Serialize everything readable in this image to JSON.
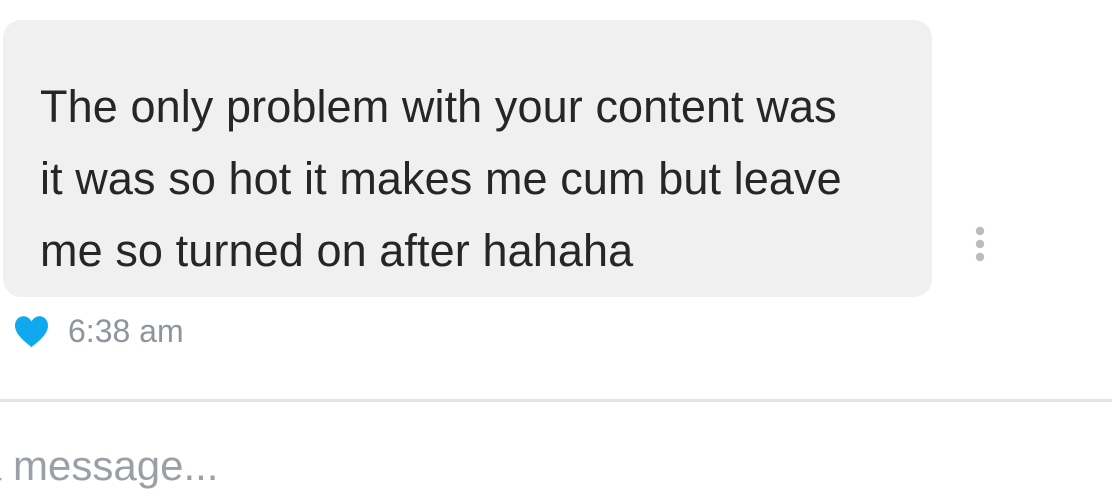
{
  "message": {
    "lines": [
      "The only problem with your content was",
      "it was so hot it makes me cum but leave",
      "me so turned on after hahaha"
    ],
    "time": "6:38 am",
    "liked": true
  },
  "composer": {
    "placeholder": "a message..."
  },
  "colors": {
    "bubble": "#f0f0f1",
    "heart": "#10a8ef",
    "timestamp": "#8f959c",
    "placeholder": "#9aa0a6",
    "divider": "#e2e4e6",
    "menu_dots": "#b8bcc0"
  },
  "icons": {
    "like": "heart-icon",
    "options": "vertical-ellipsis-icon"
  }
}
